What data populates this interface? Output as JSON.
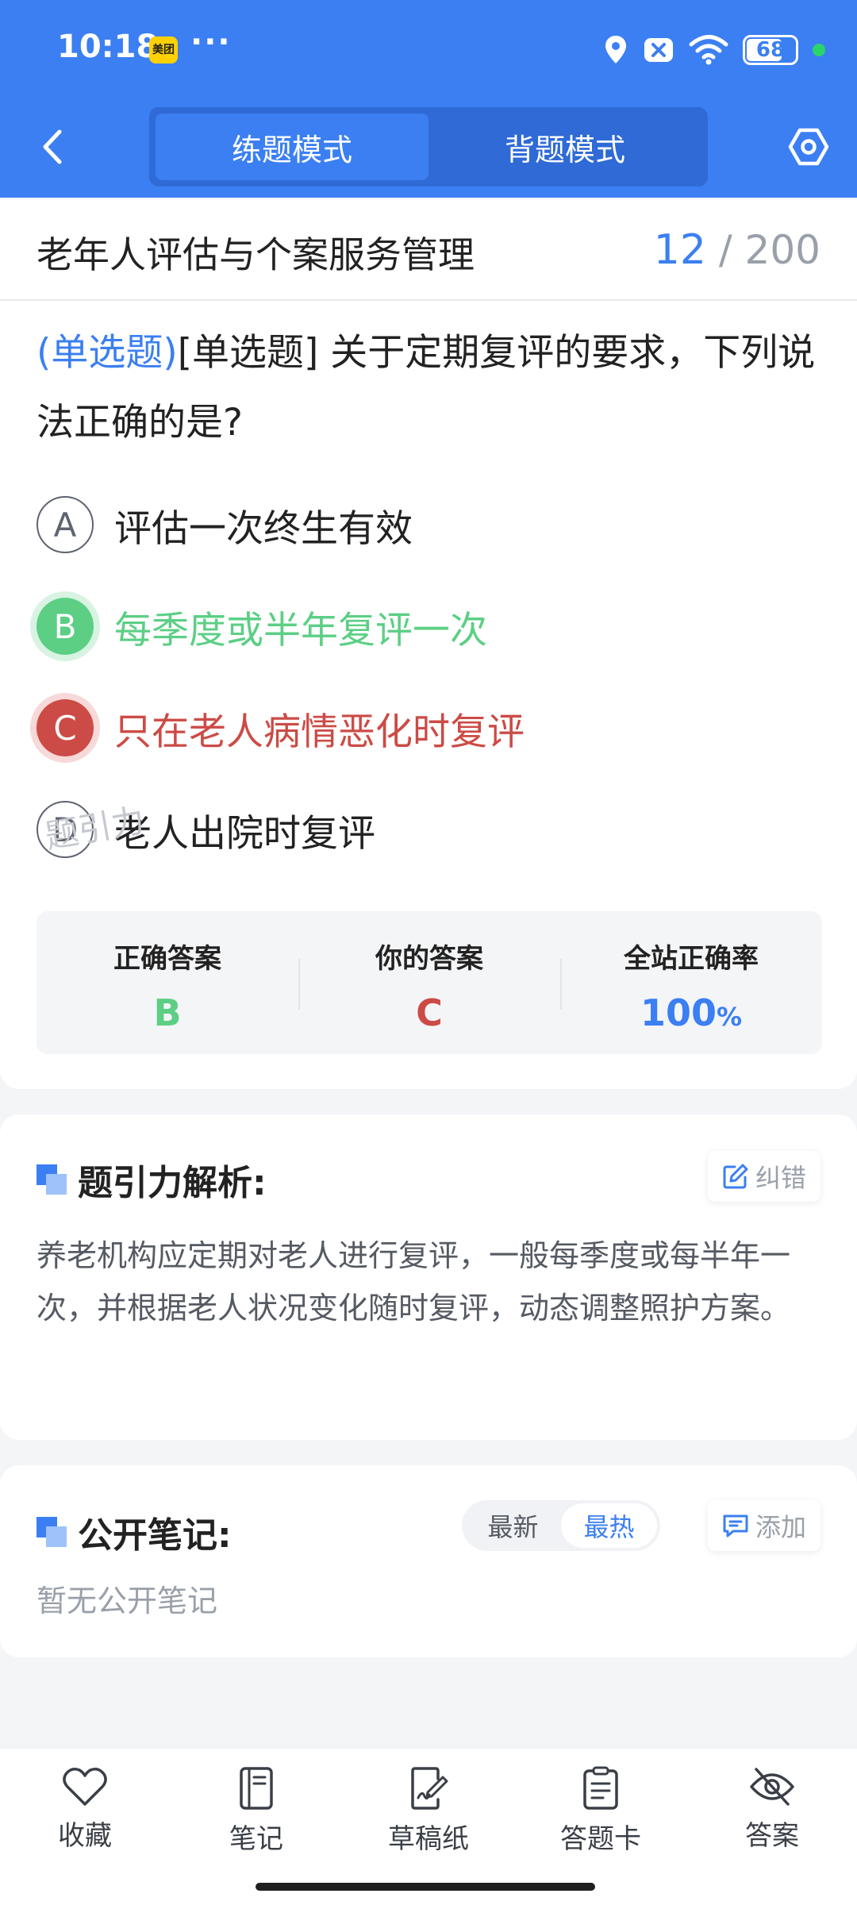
{
  "status_bar": {
    "time": "10:18",
    "app_badge": "美团",
    "more": "···",
    "battery": "68",
    "battery_level": 0.68,
    "icons": [
      "location-icon",
      "mute-icon",
      "wifi-icon",
      "battery-icon",
      "green-dot-indicator"
    ]
  },
  "header": {
    "tabs": [
      {
        "label": "练题模式",
        "active": true
      },
      {
        "label": "背题模式",
        "active": false
      }
    ],
    "icons": {
      "back": "chevron-left-icon",
      "settings": "settings-hexagon-icon"
    }
  },
  "question_card": {
    "subject": "老年人评估与个案服务管理",
    "current": "12",
    "total": "/ 200",
    "type_tag": "(单选题)",
    "question_text": "[单选题] 关于定期复评的要求，下列说法正确的是?",
    "options": [
      {
        "key": "A",
        "text": "评估一次终生有效",
        "state": "normal"
      },
      {
        "key": "B",
        "text": "每季度或半年复评一次",
        "state": "correct"
      },
      {
        "key": "C",
        "text": "只在老人病情恶化时复评",
        "state": "wrong"
      },
      {
        "key": "D",
        "text": "老人出院时复评",
        "state": "normal"
      }
    ],
    "result": {
      "correct_label": "正确答案",
      "correct_value": "B",
      "yours_label": "你的答案",
      "yours_value": "C",
      "rate_label": "全站正确率",
      "rate_value": "100",
      "rate_unit": "%"
    },
    "watermark": "题引力"
  },
  "analysis": {
    "title": "题引力解析:",
    "report_button": "纠错",
    "text": "养老机构应定期对老人进行复评，一般每季度或每半年一次，并根据老人状况变化随时复评，动态调整照护方案。"
  },
  "notes": {
    "title": "公开笔记:",
    "sort_options": [
      {
        "label": "最新",
        "active": false
      },
      {
        "label": "最热",
        "active": true
      }
    ],
    "add_button": "添加",
    "empty_text": "暂无公开笔记"
  },
  "bottom_nav": [
    {
      "label": "收藏",
      "icon": "heart-icon"
    },
    {
      "label": "笔记",
      "icon": "notebook-icon"
    },
    {
      "label": "草稿纸",
      "icon": "draft-paper-icon"
    },
    {
      "label": "答题卡",
      "icon": "answer-sheet-icon"
    },
    {
      "label": "答案",
      "icon": "eye-off-icon"
    }
  ],
  "colors": {
    "primary": "#3b7ff2",
    "correct": "#5ccf85",
    "wrong": "#cc4b46",
    "background": "#f4f5f7"
  }
}
